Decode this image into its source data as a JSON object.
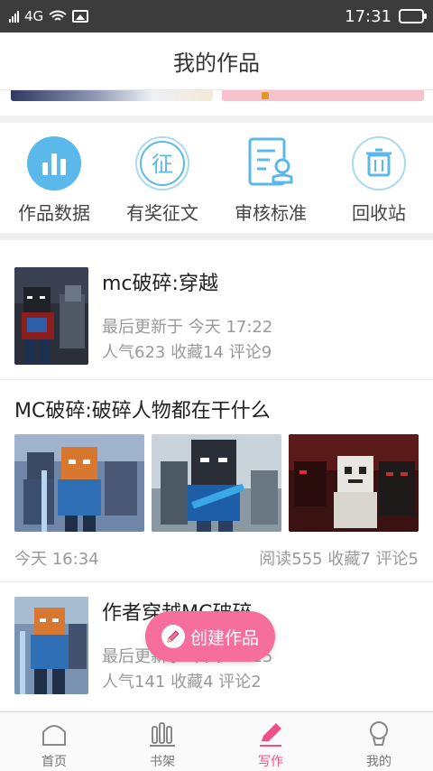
{
  "status_bar": {
    "network": "4G",
    "time": "17:31"
  },
  "header": {
    "title": "我的作品"
  },
  "quick_actions": [
    {
      "label": "作品数据",
      "icon": "bar-chart-icon"
    },
    {
      "label": "有奖征文",
      "icon": "contest-icon",
      "glyph": "征"
    },
    {
      "label": "审核标准",
      "icon": "review-document-icon"
    },
    {
      "label": "回收站",
      "icon": "trash-icon"
    }
  ],
  "feed": {
    "work1": {
      "title": "mc破碎:穿越",
      "updated": "最后更新于 今天 17:22",
      "stats": "人气623 收藏14 评论9"
    },
    "post": {
      "title": "MC破碎:破碎人物都在干什么",
      "time": "今天 16:34",
      "stats": "阅读555 收藏7 评论5"
    },
    "work2": {
      "title": "作者穿越MC破碎",
      "updated": "最后更新于 今天 17:15",
      "stats": "人气141 收藏4 评论2"
    }
  },
  "create_button": {
    "label": "创建作品"
  },
  "bottom_nav": [
    {
      "label": "首页",
      "icon": "home-icon",
      "active": false
    },
    {
      "label": "书架",
      "icon": "bookshelf-icon",
      "active": false
    },
    {
      "label": "写作",
      "icon": "write-pen-icon",
      "active": true
    },
    {
      "label": "我的",
      "icon": "profile-icon",
      "active": false
    }
  ],
  "colors": {
    "accent": "#f66e9c",
    "icon_blue": "#5bb8ea",
    "icon_blue_light": "#a9d9f3",
    "text_muted": "#999999"
  }
}
